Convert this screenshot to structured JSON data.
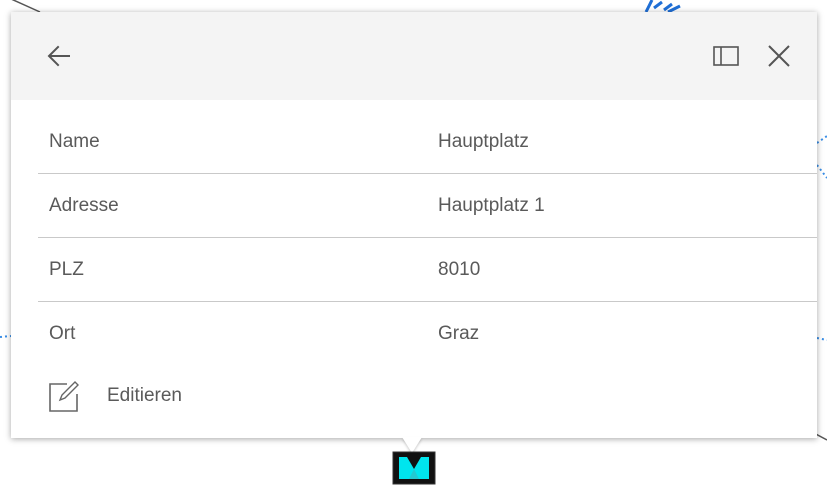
{
  "popup": {
    "header": {
      "back_icon": "arrow-left-icon",
      "dock_icon": "dock-panel-icon",
      "close_icon": "close-icon"
    },
    "attributes": [
      {
        "key": "Name",
        "value": "Hauptplatz"
      },
      {
        "key": "Adresse",
        "value": "Hauptplatz 1"
      },
      {
        "key": "PLZ",
        "value": "8010"
      },
      {
        "key": "Ort",
        "value": "Graz"
      }
    ],
    "edit": {
      "icon": "edit-icon",
      "label": "Editieren"
    }
  },
  "colors": {
    "header_bg": "#f4f4f4",
    "text": "#5a5a5a",
    "divider": "#c9c9c9",
    "marker_fill": "#00e5ee",
    "map_line": "#1f6fd6"
  }
}
